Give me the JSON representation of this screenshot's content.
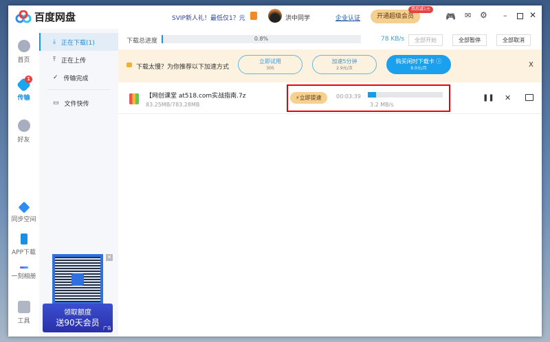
{
  "app": {
    "title": "百度网盘"
  },
  "header": {
    "promo": "SVIP新人礼！最低仅1？元",
    "username": "洪中同学",
    "enterprise": "企业认证",
    "vip_button": "开通超级会员",
    "vip_badge": "券后减1元"
  },
  "nav": [
    {
      "label": "首页"
    },
    {
      "label": "传输",
      "badge": "1"
    },
    {
      "label": "好友"
    },
    {
      "label": "同步空间"
    },
    {
      "label": "APP下载"
    },
    {
      "label": "一刻相册"
    },
    {
      "label": "工具"
    }
  ],
  "side": [
    {
      "label": "正在下载(1)"
    },
    {
      "label": "正在上传"
    },
    {
      "label": "传输完成"
    },
    {
      "label": "文件快传"
    }
  ],
  "progress": {
    "label": "下载总进度",
    "percent_text": "0.8%",
    "percent": 0.8,
    "speed": "78 KB/s",
    "start_all": "全部开始",
    "pause_all": "全部暂停",
    "cancel_all": "全部取消"
  },
  "banner": {
    "text": "下载太慢？为你推荐以下加速方式",
    "opt1": "立即试用",
    "opt1_sub": "30S",
    "opt2": "加速5分钟",
    "opt2_sub": "2.9元/次",
    "opt3": "购买闲时下载卡",
    "opt3_sub": "8.9元/月",
    "close": "X"
  },
  "file": {
    "name": "【网创课堂 at518.com实战指南.7z",
    "size": "83.25MB/783.28MB",
    "boost": "立即提速",
    "time": "00:03:39",
    "speed": "3.2 MB/s",
    "percent": 10.6
  },
  "ad": {
    "line1": "领取额度",
    "line2": "送90天会员",
    "tag": "广告",
    "qr_label": "cloud"
  }
}
